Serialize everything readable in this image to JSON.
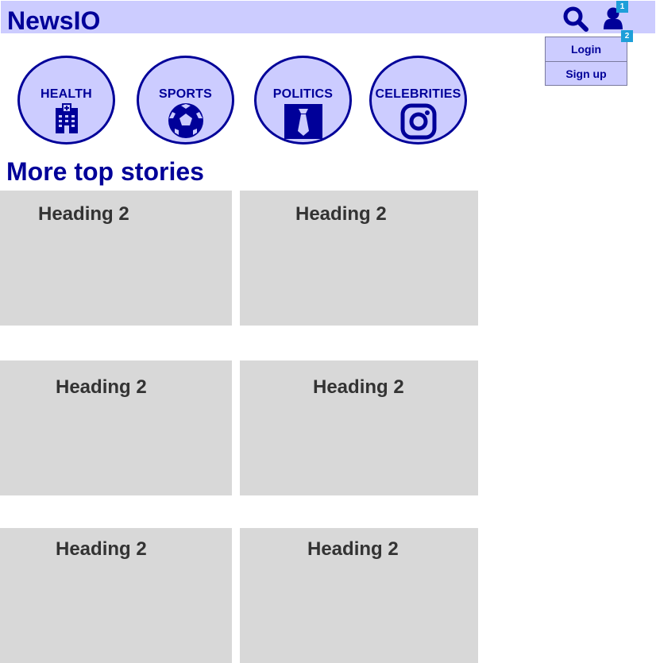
{
  "header": {
    "logo": "NewsIO",
    "markers": {
      "user": "1",
      "dropdown": "2"
    },
    "icons": {
      "search": "search-icon",
      "user": "user-icon"
    }
  },
  "account_menu": {
    "items": [
      {
        "label": "Login"
      },
      {
        "label": "Sign up"
      }
    ]
  },
  "categories": [
    {
      "label": "HEALTH",
      "icon": "hospital-icon"
    },
    {
      "label": "SPORTS",
      "icon": "soccer-ball-icon"
    },
    {
      "label": "POLITICS",
      "icon": "tie-icon"
    },
    {
      "label": "CELEBRITIES",
      "icon": "instagram-icon"
    }
  ],
  "main": {
    "section_title": "More top stories",
    "cards": [
      {
        "heading": "Heading 2"
      },
      {
        "heading": "Heading 2"
      },
      {
        "heading": "Heading 2"
      },
      {
        "heading": "Heading 2"
      },
      {
        "heading": "Heading 2"
      },
      {
        "heading": "Heading 2"
      }
    ]
  },
  "colors": {
    "primary": "#000099",
    "header_bg": "#ccccff",
    "card_bg": "#d8d8d8",
    "heading_text": "#333333",
    "marker": "#1e9fd9"
  }
}
